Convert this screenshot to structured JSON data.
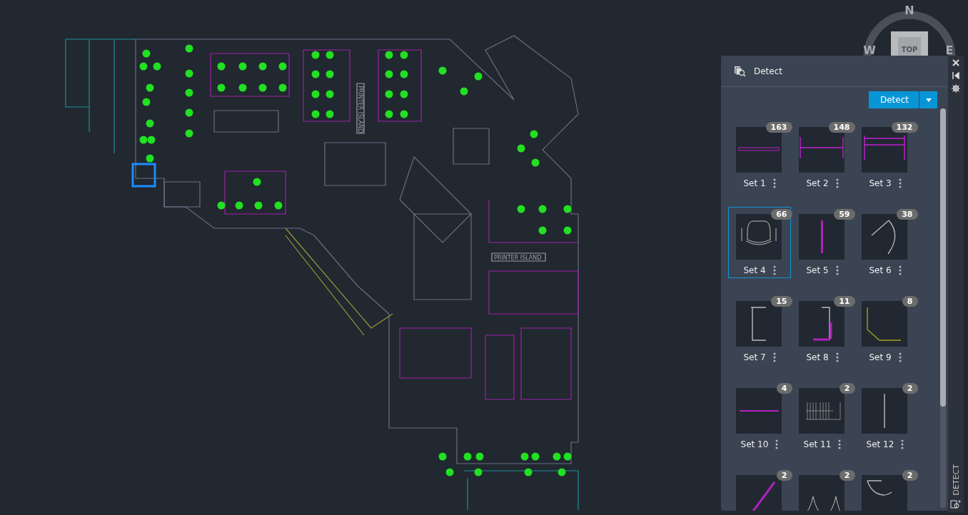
{
  "floor_plan": {
    "labels": [
      "PRINTER ISLAND",
      "PRINTER ISLAND"
    ]
  },
  "viewcube": {
    "north": "N",
    "west": "W",
    "east": "E",
    "face": "TOP"
  },
  "panel": {
    "title": "Detect",
    "detect_button": "Detect",
    "side_tab": "DETECT"
  },
  "sets": [
    {
      "name": "Set 1",
      "count": "163",
      "selected": false
    },
    {
      "name": "Set 2",
      "count": "148",
      "selected": false
    },
    {
      "name": "Set 3",
      "count": "132",
      "selected": false
    },
    {
      "name": "Set 4",
      "count": "66",
      "selected": true
    },
    {
      "name": "Set 5",
      "count": "59",
      "selected": false
    },
    {
      "name": "Set 6",
      "count": "38",
      "selected": false
    },
    {
      "name": "Set 7",
      "count": "15",
      "selected": false
    },
    {
      "name": "Set 8",
      "count": "11",
      "selected": false
    },
    {
      "name": "Set 9",
      "count": "8",
      "selected": false
    },
    {
      "name": "Set 10",
      "count": "4",
      "selected": false
    },
    {
      "name": "Set 11",
      "count": "2",
      "selected": false
    },
    {
      "name": "Set 12",
      "count": "2",
      "selected": false
    },
    {
      "count": "2",
      "selected": false
    },
    {
      "count": "2",
      "selected": false
    },
    {
      "count": "2",
      "selected": false
    }
  ]
}
